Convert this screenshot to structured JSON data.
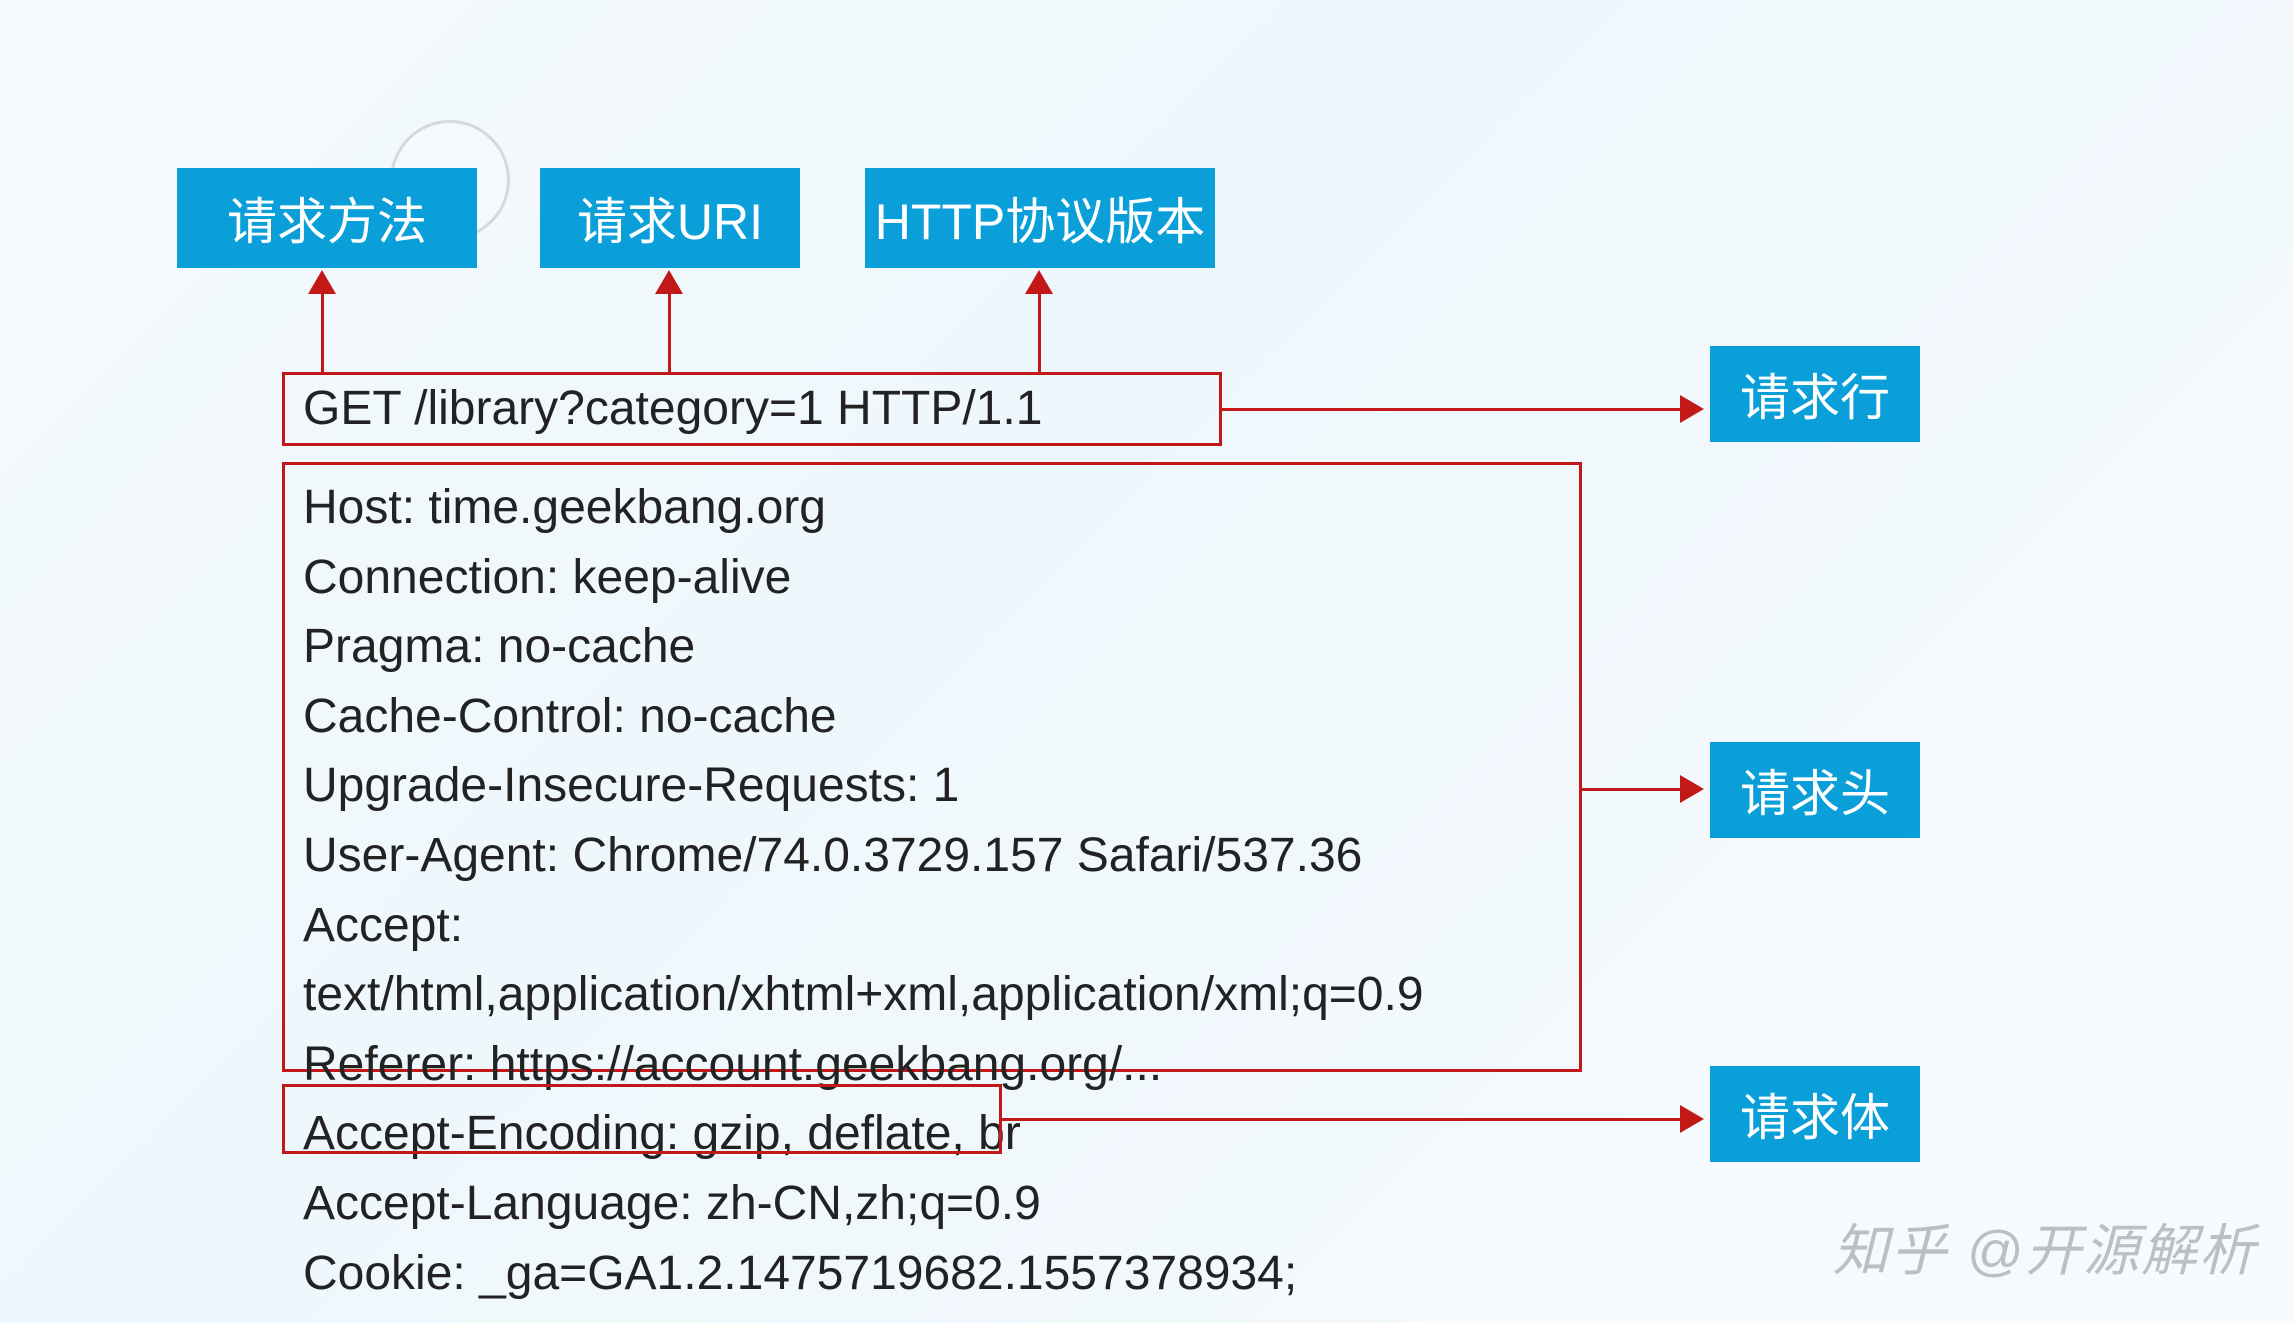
{
  "top_labels": {
    "method": "请求方法",
    "uri": "请求URI",
    "version": "HTTP协议版本"
  },
  "right_labels": {
    "request_line": "请求行",
    "request_headers": "请求头",
    "request_body": "请求体"
  },
  "request_line_text": "GET /library?category=1 HTTP/1.1",
  "headers": [
    "Host: time.geekbang.org",
    "Connection: keep-alive",
    "Pragma: no-cache",
    "Cache-Control: no-cache",
    "Upgrade-Insecure-Requests: 1",
    "User-Agent: Chrome/74.0.3729.157 Safari/537.36",
    "Accept: text/html,application/xhtml+xml,application/xml;q=0.9",
    "Referer: https://account.geekbang.org/...",
    "Accept-Encoding: gzip, deflate, br",
    "Accept-Language: zh-CN,zh;q=0.9",
    "Cookie: _ga=GA1.2.1475719682.1557378934;"
  ],
  "body_text": "",
  "watermark": "知乎 @开源解析"
}
